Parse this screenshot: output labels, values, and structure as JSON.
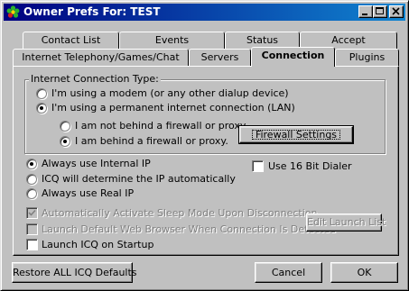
{
  "window": {
    "title": "Owner Prefs For: TEST",
    "app_icon": "icq-flower-icon"
  },
  "tabs_row1": [
    {
      "label": "Contact List"
    },
    {
      "label": "Events"
    },
    {
      "label": "Status"
    },
    {
      "label": "Accept"
    }
  ],
  "tabs_row2": [
    {
      "label": "Internet Telephony/Games/Chat"
    },
    {
      "label": "Servers"
    },
    {
      "label": "Connection",
      "active": true
    },
    {
      "label": "Plugins"
    }
  ],
  "connection_group": {
    "title": "Internet Connection Type:",
    "options": [
      {
        "label": "I'm using a modem (or any other dialup device)",
        "selected": false
      },
      {
        "label": "I'm using a permanent internet connection (LAN)",
        "selected": true
      }
    ],
    "firewall_options": [
      {
        "label": "I am not behind a firewall or proxy.",
        "selected": false
      },
      {
        "label": "I am behind a firewall or proxy.",
        "selected": true
      }
    ],
    "firewall_button": "Firewall Settings"
  },
  "ip_options": [
    {
      "label": "Always use Internal IP",
      "selected": true
    },
    {
      "label": "ICQ will determine the IP automatically",
      "selected": false
    },
    {
      "label": "Always use Real IP",
      "selected": false
    }
  ],
  "dialer_checkbox": {
    "label": "Use 16 Bit Dialer",
    "checked": false
  },
  "misc_checks": [
    {
      "label": "Automatically Activate Sleep Mode Upon Disconnection",
      "checked": true,
      "disabled": true
    },
    {
      "label": "Launch Default Web Browser When Connection Is Detected",
      "checked": false,
      "disabled": true
    },
    {
      "label": "Launch ICQ on Startup",
      "checked": false,
      "disabled": false
    }
  ],
  "edit_launch_button": "Edit Launch List",
  "footer": {
    "restore_button": "Restore ALL ICQ Defaults",
    "cancel_button": "Cancel",
    "ok_button": "OK"
  },
  "colors": {
    "titlebar_start": "#000080",
    "titlebar_end": "#1084d0",
    "face": "#c0c0c0"
  }
}
